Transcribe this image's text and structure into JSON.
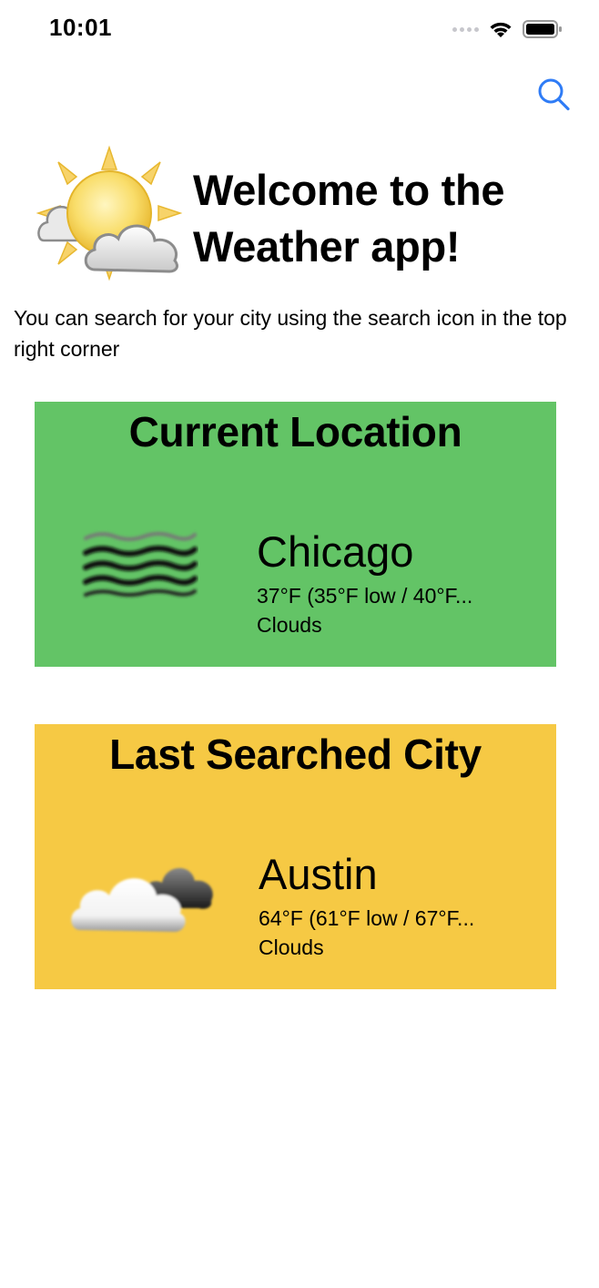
{
  "status_bar": {
    "time": "10:01",
    "icons": [
      "signal-icon",
      "wifi-icon",
      "battery-icon"
    ]
  },
  "nav": {
    "search_icon": "search-icon",
    "accent_color": "#2f7cf6"
  },
  "welcome": {
    "icon": "sun-cloud-icon",
    "title": "Welcome to the Weather app!",
    "subtitle": "You can search for your city using the search icon in the top right corner"
  },
  "current_location": {
    "heading": "Current Location",
    "icon": "fog-icon",
    "city": "Chicago",
    "temperature": "37°F  (35°F low / 40°F...",
    "condition": "Clouds",
    "color": "#63c466"
  },
  "last_searched": {
    "heading": "Last Searched City",
    "icon": "clouds-icon",
    "city": "Austin",
    "temperature": "64°F  (61°F low / 67°F...",
    "condition": "Clouds",
    "color": "#f6c944"
  }
}
